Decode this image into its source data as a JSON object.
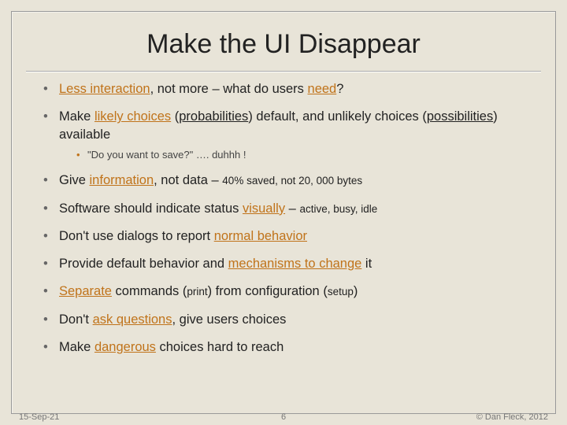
{
  "title": "Make the UI Disappear",
  "bullets": [
    {
      "html": "<span class='accent'>Less interaction</span>, not more – what do users <span class='accent'>need</span>?"
    },
    {
      "html": "Make <span class='accent'>likely choices</span> (<span class='u'>probabilities</span>) default, and unlikely choices (<span class='u'>possibilities</span>) available",
      "sub": "\"Do you want to save?\" …. duhhh !"
    },
    {
      "html": "Give <span class='accent'>information</span>, not data – <span class='small'>40% saved, not 20, 000 bytes</span>"
    },
    {
      "html": "Software should indicate status <span class='accent'>visually</span> – <span class='small'>active, busy, idle</span>"
    },
    {
      "html": "Don't use dialogs to report <span class='accent'>normal behavior</span>"
    },
    {
      "html": "Provide default behavior and <span class='accent'>mechanisms to change</span> it"
    },
    {
      "html": "<span class='accent'>Separate</span> commands (<span class='small'>print</span>) from configuration (<span class='small'>setup</span>)"
    },
    {
      "html": "Don't <span class='accent'>ask questions</span>, give users choices"
    },
    {
      "html": "Make <span class='accent'>dangerous</span> choices hard to reach"
    }
  ],
  "footer": {
    "date": "15-Sep-21",
    "page": "6",
    "copyright": "© Dan Fleck, 2012"
  }
}
